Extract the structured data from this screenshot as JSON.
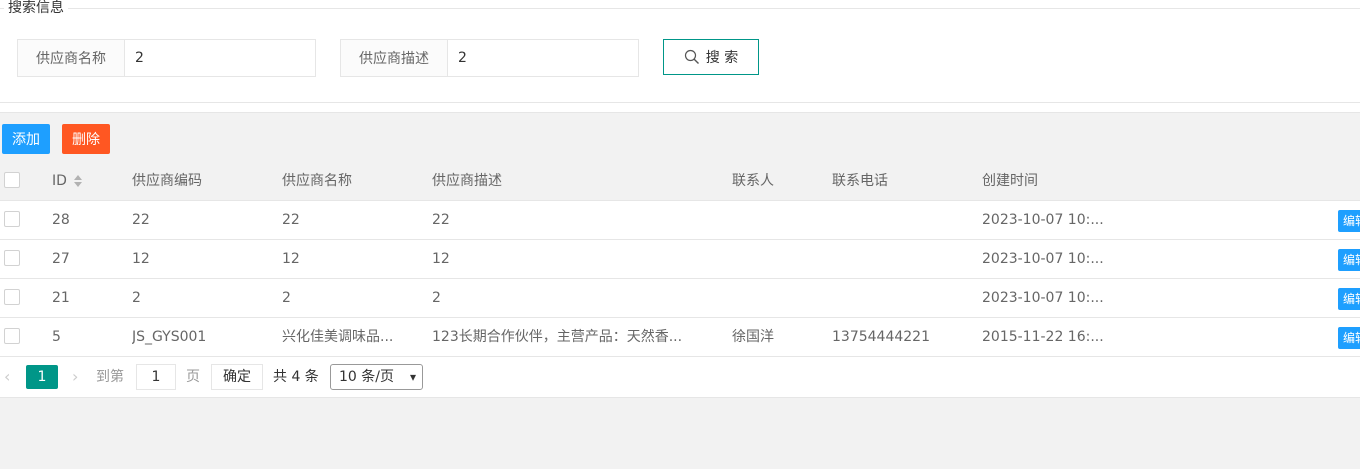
{
  "search": {
    "legend": "搜索信息",
    "name_label": "供应商名称",
    "name_value": "2",
    "desc_label": "供应商描述",
    "desc_value": "2",
    "search_button": "搜 索"
  },
  "toolbar": {
    "add_label": "添加",
    "delete_label": "删除"
  },
  "table": {
    "headers": [
      "ID",
      "供应商编码",
      "供应商名称",
      "供应商描述",
      "联系人",
      "联系电话",
      "创建时间"
    ],
    "rows": [
      {
        "id": "28",
        "code": "22",
        "name": "22",
        "desc": "22",
        "contact": "",
        "phone": "",
        "created": "2023-10-07 10:...",
        "edit": "编辑"
      },
      {
        "id": "27",
        "code": "12",
        "name": "12",
        "desc": "12",
        "contact": "",
        "phone": "",
        "created": "2023-10-07 10:...",
        "edit": "编辑"
      },
      {
        "id": "21",
        "code": "2",
        "name": "2",
        "desc": "2",
        "contact": "",
        "phone": "",
        "created": "2023-10-07 10:...",
        "edit": "编辑"
      },
      {
        "id": "5",
        "code": "JS_GYS001",
        "name": "兴化佳美调味品...",
        "desc": "123长期合作伙伴，主营产品：天然香...",
        "contact": "徐国洋",
        "phone": "13754444221",
        "created": "2015-11-22 16:...",
        "edit": "编辑"
      }
    ]
  },
  "pager": {
    "prev": "‹",
    "current_page": "1",
    "next": "›",
    "goto_label": "到第",
    "goto_value": "1",
    "page_unit": "页",
    "confirm": "确定",
    "total": "共 4 条",
    "page_size": "10 条/页"
  },
  "colors": {
    "primary": "#009688",
    "blue": "#1e9fff",
    "orange": "#ff5722"
  }
}
